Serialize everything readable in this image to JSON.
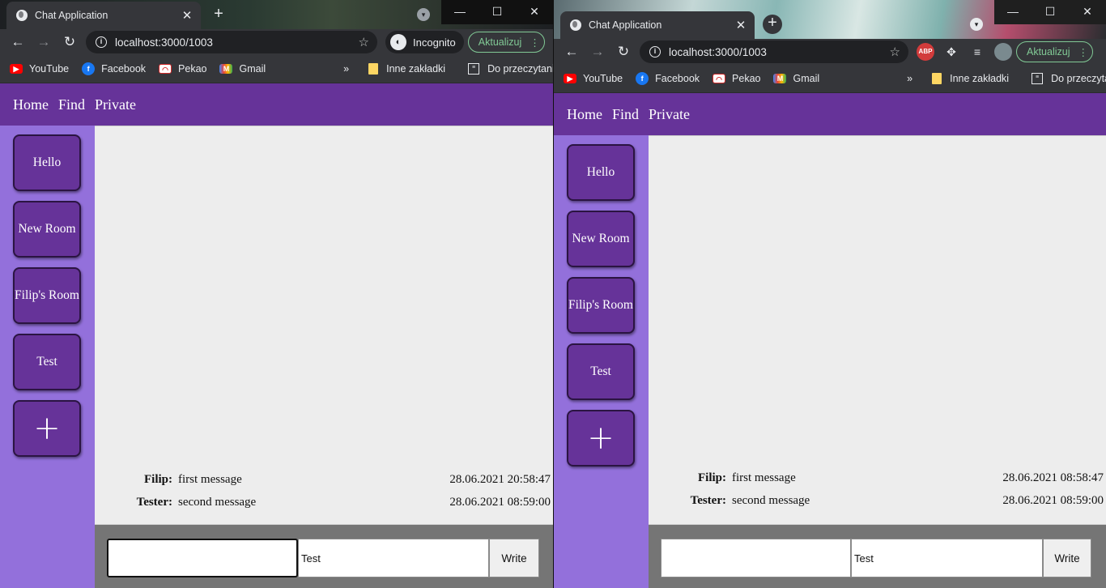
{
  "tab": {
    "title": "Chat Application",
    "close": "✕"
  },
  "toolbar": {
    "url": "localhost:3000/1003",
    "incognito_label": "Incognito",
    "update_label": "Aktualizuj",
    "abp_label": "ABP"
  },
  "bookmarks": {
    "items": [
      {
        "label": "YouTube"
      },
      {
        "label": "Facebook"
      },
      {
        "label": "Pekao"
      },
      {
        "label": "Gmail"
      }
    ],
    "more": "»",
    "other_folder": "Inne zakładki",
    "reading_list": "Do przeczytania"
  },
  "nav": {
    "links": [
      "Home",
      "Find",
      "Private"
    ]
  },
  "rooms": [
    "Hello",
    "New Room",
    "Filip's Room",
    "Test"
  ],
  "add_room_label": "+",
  "windows": {
    "left": {
      "messages": [
        {
          "author": "Filip:",
          "text": "first message",
          "time": "28.06.2021 20:58:47"
        },
        {
          "author": "Tester:",
          "text": "second message",
          "time": "28.06.2021 08:59:00"
        }
      ],
      "composer": {
        "author_value": "",
        "text_value": "Test",
        "button": "Write"
      }
    },
    "right": {
      "messages": [
        {
          "author": "Filip:",
          "text": "first message",
          "time": "28.06.2021 08:58:47"
        },
        {
          "author": "Tester:",
          "text": "second message",
          "time": "28.06.2021 08:59:00"
        }
      ],
      "composer": {
        "author_value": "",
        "text_value": "Test",
        "button": "Write"
      }
    }
  },
  "colors": {
    "nav_bg": "#663399",
    "sidebar_bg": "#9370db",
    "room_bg": "#663399",
    "chat_bg": "#ededed",
    "composer_bg": "#757575",
    "update_accent": "#81c995"
  },
  "icons": {
    "globe": "globe-icon",
    "back": "arrow-left-icon",
    "forward": "arrow-right-icon",
    "reload": "reload-icon",
    "info": "info-icon",
    "star": "star-icon",
    "incognito": "incognito-icon",
    "extensions": "puzzle-icon",
    "media": "media-control-icon"
  }
}
